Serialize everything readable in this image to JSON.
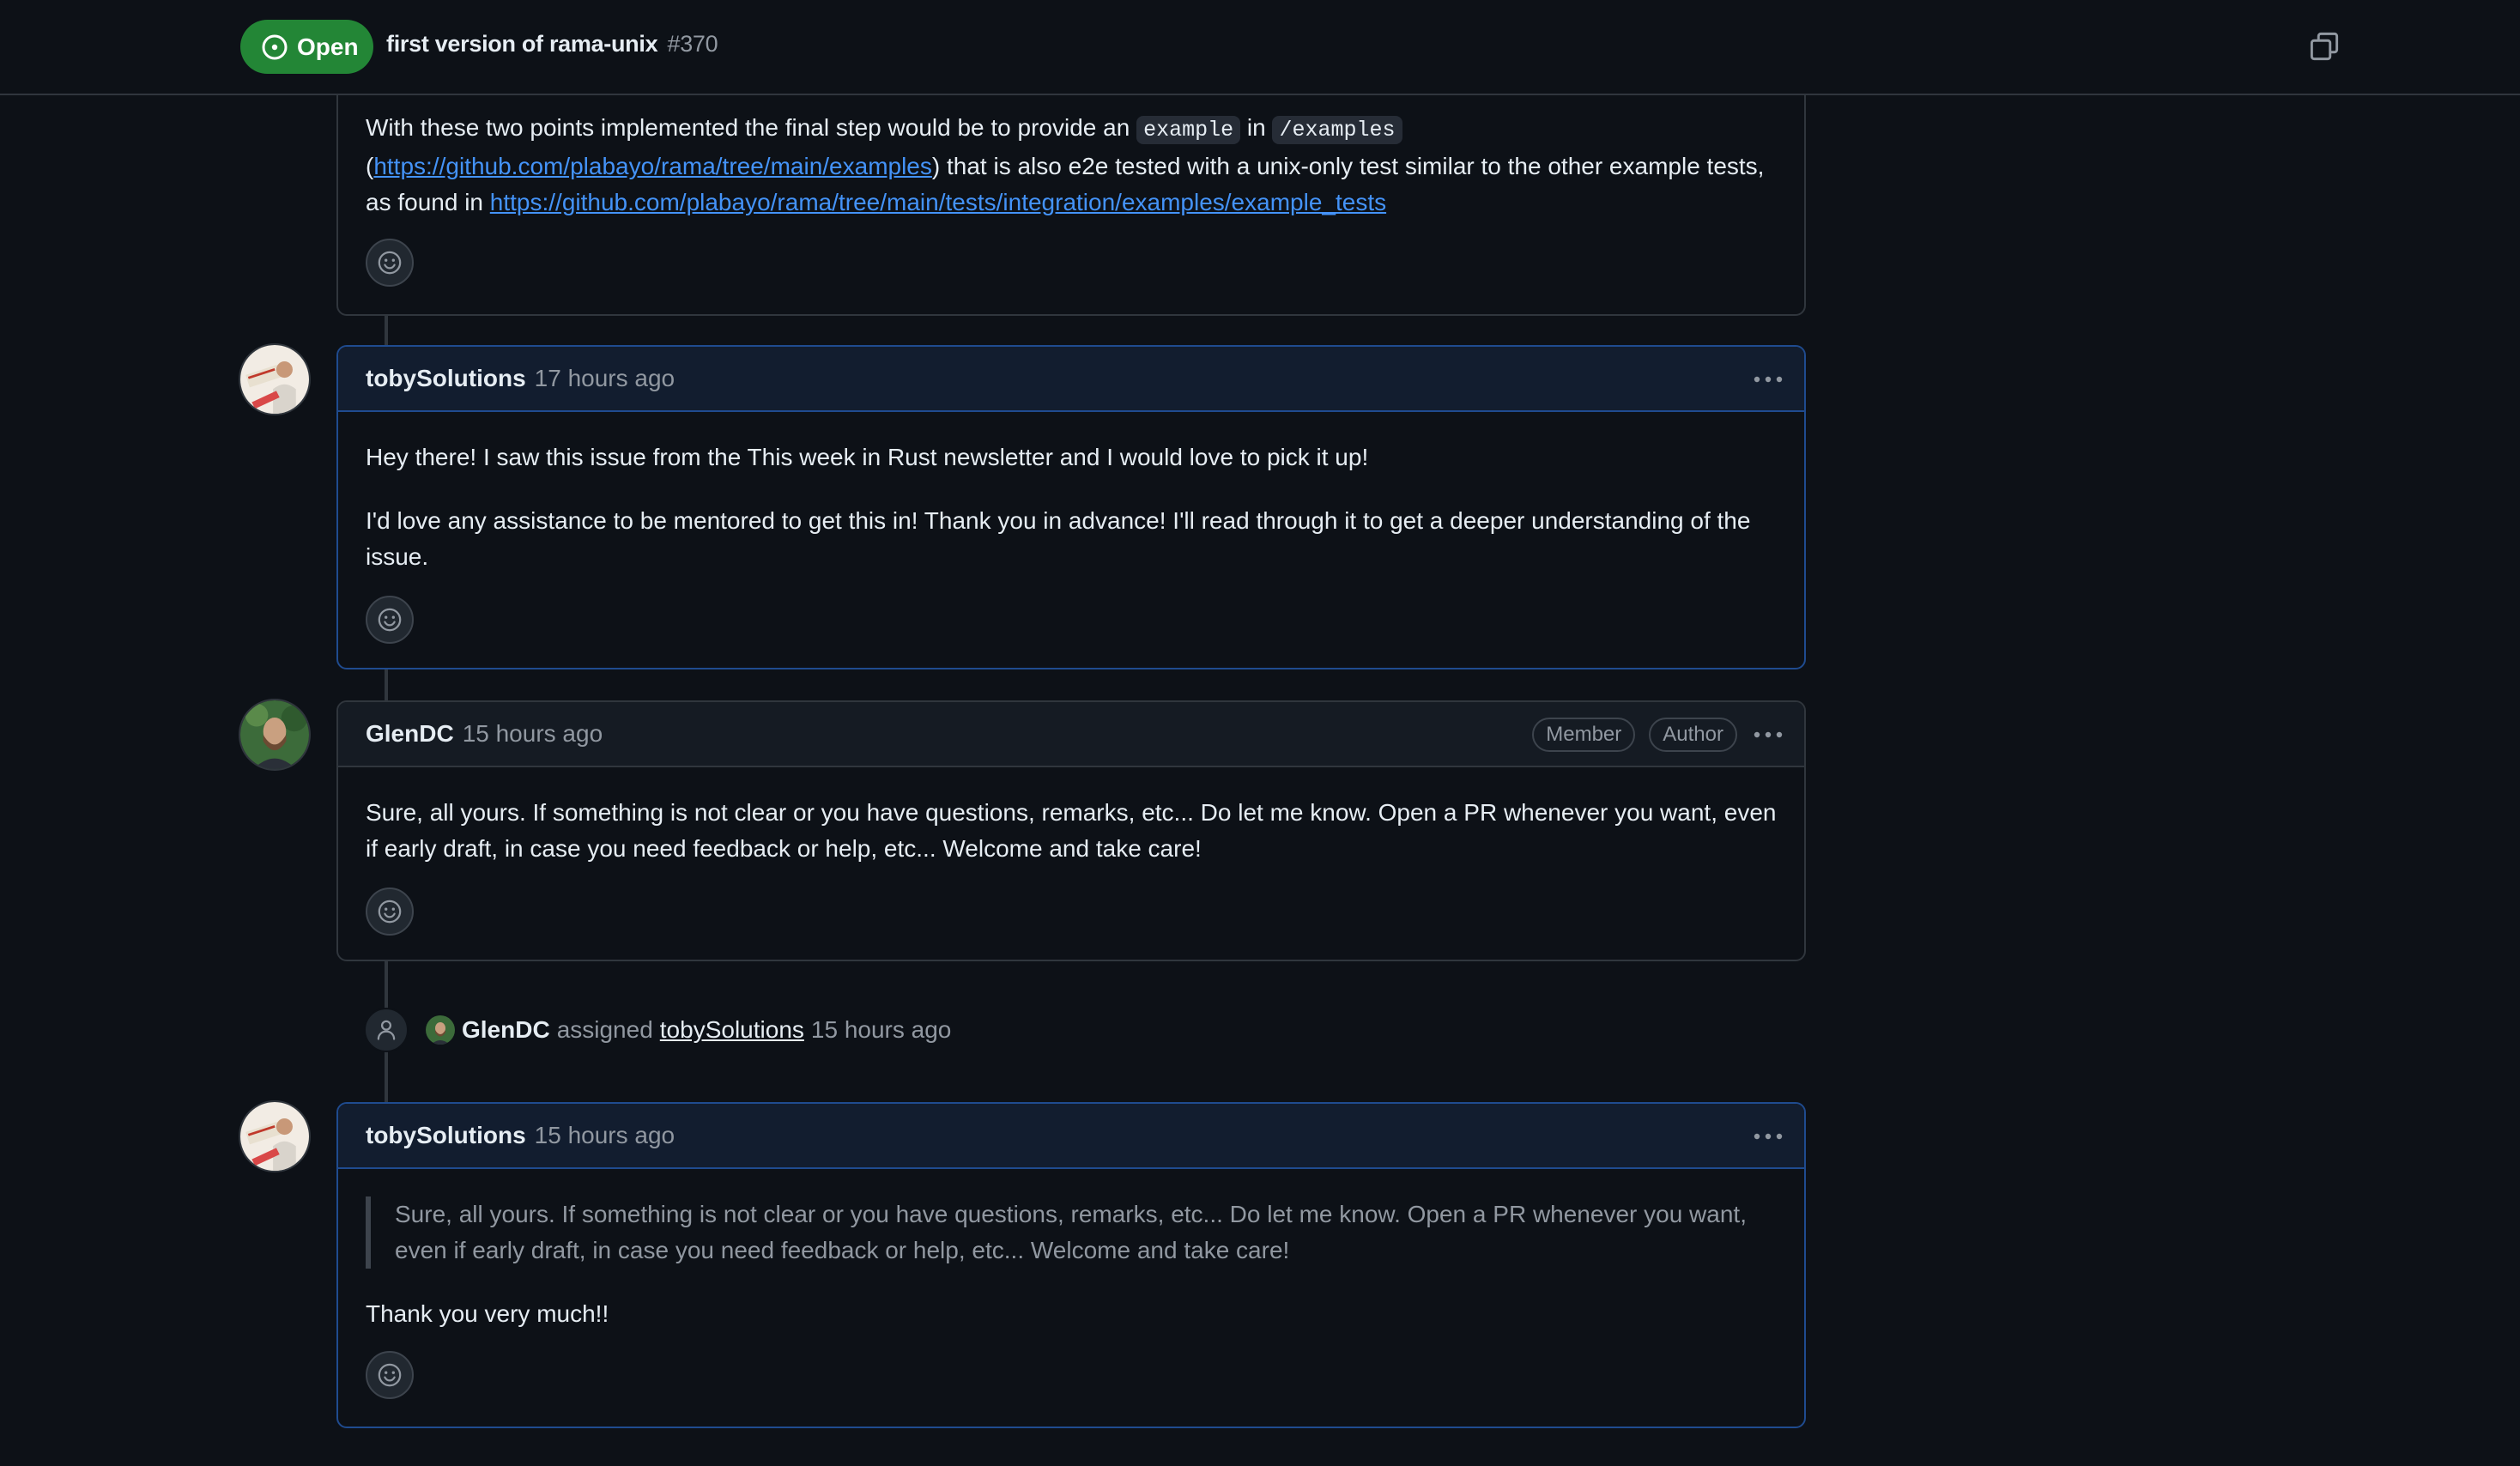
{
  "header": {
    "state_label": "Open",
    "title": "first version of rama-unix",
    "number": "#370"
  },
  "icons": {
    "state": "issue-opened-icon",
    "copy": "copy-icon",
    "reaction": "smiley-icon",
    "kebab": "kebab-horizontal-icon",
    "assigned": "person-icon"
  },
  "colors": {
    "open_badge": "#238636",
    "link": "#4493f8",
    "background": "#0d1117",
    "highlight_border": "#1f4b8f"
  },
  "comment0": {
    "text_1": "With these two points implemented the final step would be to provide an ",
    "code_1": "example",
    "text_2": " in ",
    "code_2": "/examples",
    "text_3": " (",
    "link_1": "https://github.com/plabayo/rama/tree/main/examples",
    "text_4": ") that is also e2e tested with a unix-only test similar to the other example tests, as found in ",
    "link_2": "https://github.com/plabayo/rama/tree/main/tests/integration/examples/example_tests"
  },
  "comment1": {
    "author": "tobySolutions",
    "time": "17 hours ago",
    "paragraph_1": "Hey there! I saw this issue from the This week in Rust newsletter and I would love to pick it up!",
    "paragraph_2": "I'd love any assistance to be mentored to get this in! Thank you in advance! I'll read through it to get a deeper understanding of the issue."
  },
  "comment2": {
    "author": "GlenDC",
    "time": "15 hours ago",
    "badges": [
      "Member",
      "Author"
    ],
    "paragraph_1": "Sure, all yours. If something is not clear or you have questions, remarks, etc... Do let me know. Open a PR whenever you want, even if early draft, in case you need feedback or help, etc... Welcome and take care!"
  },
  "event": {
    "actor": "GlenDC",
    "verb": "assigned",
    "assignee": "tobySolutions",
    "time": "15 hours ago"
  },
  "comment3": {
    "author": "tobySolutions",
    "time": "15 hours ago",
    "quote": "Sure, all yours. If something is not clear or you have questions, remarks, etc... Do let me know. Open a PR whenever you want, even if early draft, in case you need feedback or help, etc... Welcome and take care!",
    "paragraph_1": "Thank you very much!!"
  }
}
